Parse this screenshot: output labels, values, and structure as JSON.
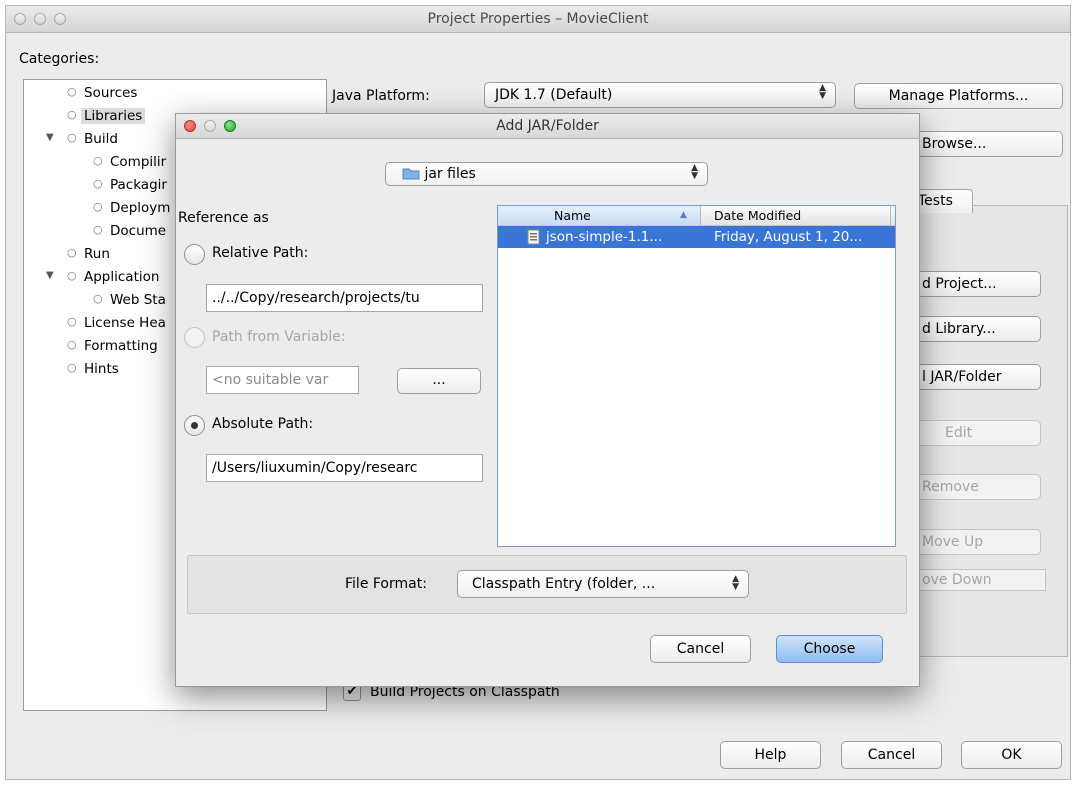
{
  "window": {
    "title": "Project Properties – MovieClient",
    "categories_label": "Categories:"
  },
  "categories": [
    {
      "label": "Sources"
    },
    {
      "label": "Libraries"
    },
    {
      "label": "Build"
    },
    {
      "label": "Compilir"
    },
    {
      "label": "Packagir"
    },
    {
      "label": "Deploym"
    },
    {
      "label": "Docume"
    },
    {
      "label": "Run"
    },
    {
      "label": "Application"
    },
    {
      "label": "Web Sta"
    },
    {
      "label": "License Hea"
    },
    {
      "label": "Formatting"
    },
    {
      "label": "Hints"
    }
  ],
  "libraries": {
    "java_platform_label": "Java Platform:",
    "java_platform_value": "JDK 1.7 (Default)",
    "manage_platforms": "Manage Platforms...",
    "browse": "Browse...",
    "tests_tab": "Tests",
    "add_project": "d Project...",
    "add_library": "d Library...",
    "add_jar_folder": "l JAR/Folder",
    "edit": "Edit",
    "remove": "Remove",
    "move_up": "Move Up",
    "move_down": "ove Down",
    "build_projects_on_classpath": "Build Projects on Classpath",
    "build_projects_checked": true
  },
  "footer": {
    "help": "Help",
    "cancel": "Cancel",
    "ok": "OK"
  },
  "dialog": {
    "title": "Add JAR/Folder",
    "folder_selector": "jar files",
    "reference_as": "Reference as",
    "relative_path_label": "Relative Path:",
    "relative_path_value": "../../Copy/research/projects/tu",
    "path_from_variable_label": "Path from Variable:",
    "path_from_variable_value": "<no suitable var",
    "variable_browse": "...",
    "absolute_path_label": "Absolute Path:",
    "absolute_path_value": "/Users/liuxumin/Copy/researc",
    "selected_option": "Absolute Path",
    "file_list": {
      "columns": [
        "Name",
        "Date Modified"
      ],
      "rows": [
        {
          "name": "json-simple-1.1...",
          "date_modified": "Friday, August 1, 20...",
          "selected": true
        }
      ]
    },
    "file_format_label": "File Format:",
    "file_format_value": "Classpath Entry (folder, ...",
    "cancel": "Cancel",
    "choose": "Choose"
  },
  "colors": {
    "selection": "#3875d7",
    "close_button": "#e0443e",
    "minimize_button": "#dea123",
    "zoom_button": "#1aab29",
    "default_button": "#a9cdf5"
  }
}
